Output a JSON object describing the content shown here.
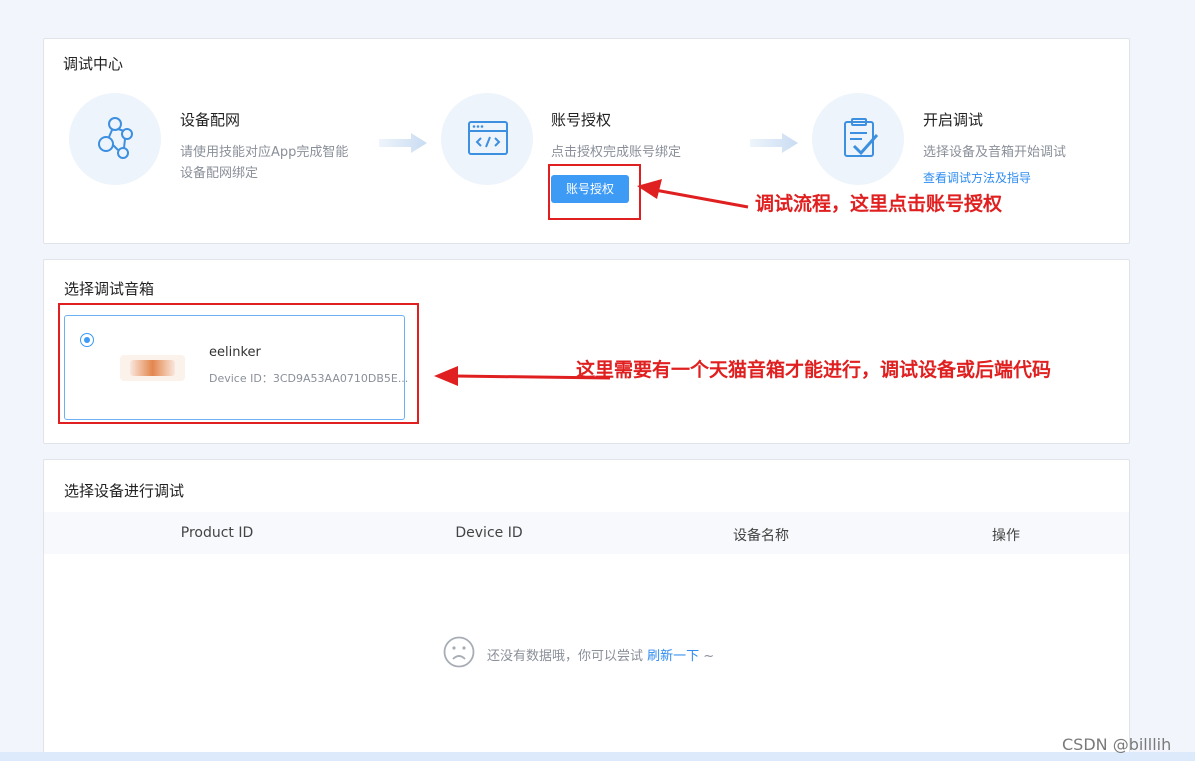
{
  "debug_center": {
    "title": "调试中心",
    "steps": [
      {
        "title": "设备配网",
        "desc_line1": "请使用技能对应App完成智能",
        "desc_line2": "设备配网绑定",
        "icon": "network-nodes-icon"
      },
      {
        "title": "账号授权",
        "desc_line1": "点击授权完成账号绑定",
        "button_label": "账号授权",
        "icon": "code-window-icon"
      },
      {
        "title": "开启调试",
        "desc_line1": "选择设备及音箱开始调试",
        "link_label": "查看调试方法及指导",
        "icon": "clipboard-check-icon"
      }
    ]
  },
  "speaker_section": {
    "title": "选择调试音箱",
    "items": [
      {
        "name": "eelinker",
        "device_id": "Device ID：3CD9A53AA0710DB5E...",
        "selected": true
      }
    ]
  },
  "device_section": {
    "title": "选择设备进行调试",
    "columns": [
      "Product ID",
      "Device ID",
      "设备名称",
      "操作"
    ],
    "empty_text": "还没有数据哦，你可以尝试",
    "refresh_link": "刷新一下",
    "empty_suffix": " ~"
  },
  "annotations": {
    "annot1": "调试流程，这里点击账号授权",
    "annot2": "这里需要有一个天猫音箱才能进行，调试设备或后端代码"
  },
  "watermark": "CSDN @billlih",
  "colors": {
    "accent": "#3d9af5",
    "annotation_red": "#e02020",
    "link": "#2f8cf0"
  }
}
